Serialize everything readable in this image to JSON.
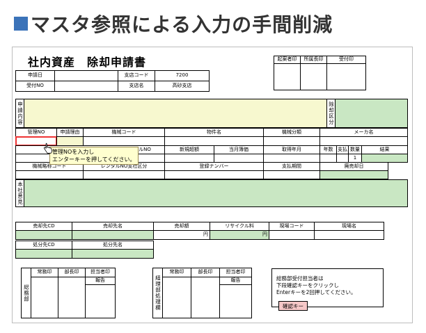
{
  "heading": {
    "title": "マスタ参照による入力の手間削減"
  },
  "form": {
    "title": "社内資産　除却申請書",
    "approval": {
      "applicant": "起案者印",
      "dept_head": "所属長印",
      "receipt": "受付印"
    },
    "apply_date_label": "申請日",
    "receipt_no_label": "受付NO",
    "branch_code_label": "支店コード",
    "branch_code_value": "7200",
    "branch_name_label": "支店名",
    "branch_name_value": "高砂支店",
    "content_label": "申請内容",
    "jokyaku_label": "除却区分",
    "asset_headers": [
      "管理NO",
      "申請理由",
      "機械コード",
      "物件名",
      "機械分類",
      "メーカ名"
    ],
    "row2": {
      "serial": "アルNO",
      "acq_value": "新規超額",
      "book_value": "当月簿価",
      "acq_date": "取得年月",
      "year": "年数",
      "pay": "支払",
      "qty": "数量",
      "result": "結果",
      "qty_value": "1"
    },
    "row3": {
      "machine_name": "機械略称コード",
      "rental": "レンタルNO支社区分",
      "reg_no": "登録ナンバー",
      "period": "支払期間",
      "disposal_date": "廃売却日"
    },
    "tooltip": {
      "line1": "管理NOを入力し",
      "line2": "エンターキーを押してください。"
    },
    "opinion_label": "本社意見",
    "sale": {
      "dest_code": "売却先CD",
      "dest_name": "売却先名",
      "amount": "売却額",
      "recycle": "リサイクル料",
      "site_code": "現場コード",
      "site_name": "現場名",
      "yen": "円"
    },
    "disposal": {
      "dest_code": "処分先CD",
      "dest_name": "処分先名"
    },
    "bottom_left": {
      "side": "総務部",
      "h1": "常務印",
      "h2": "部長印",
      "h3": "担当者印",
      "report": "報告"
    },
    "bottom_right": {
      "side": "経理部処理欄",
      "h1": "常務印",
      "h2": "部長印",
      "h3": "担当者印",
      "report": "報告"
    },
    "note": {
      "line1": "総務部受付担当者は",
      "line2": "下段確認キーをクリックし",
      "line3": "Enterキーを2回押してください。"
    },
    "confirm_button": "確認キー"
  }
}
